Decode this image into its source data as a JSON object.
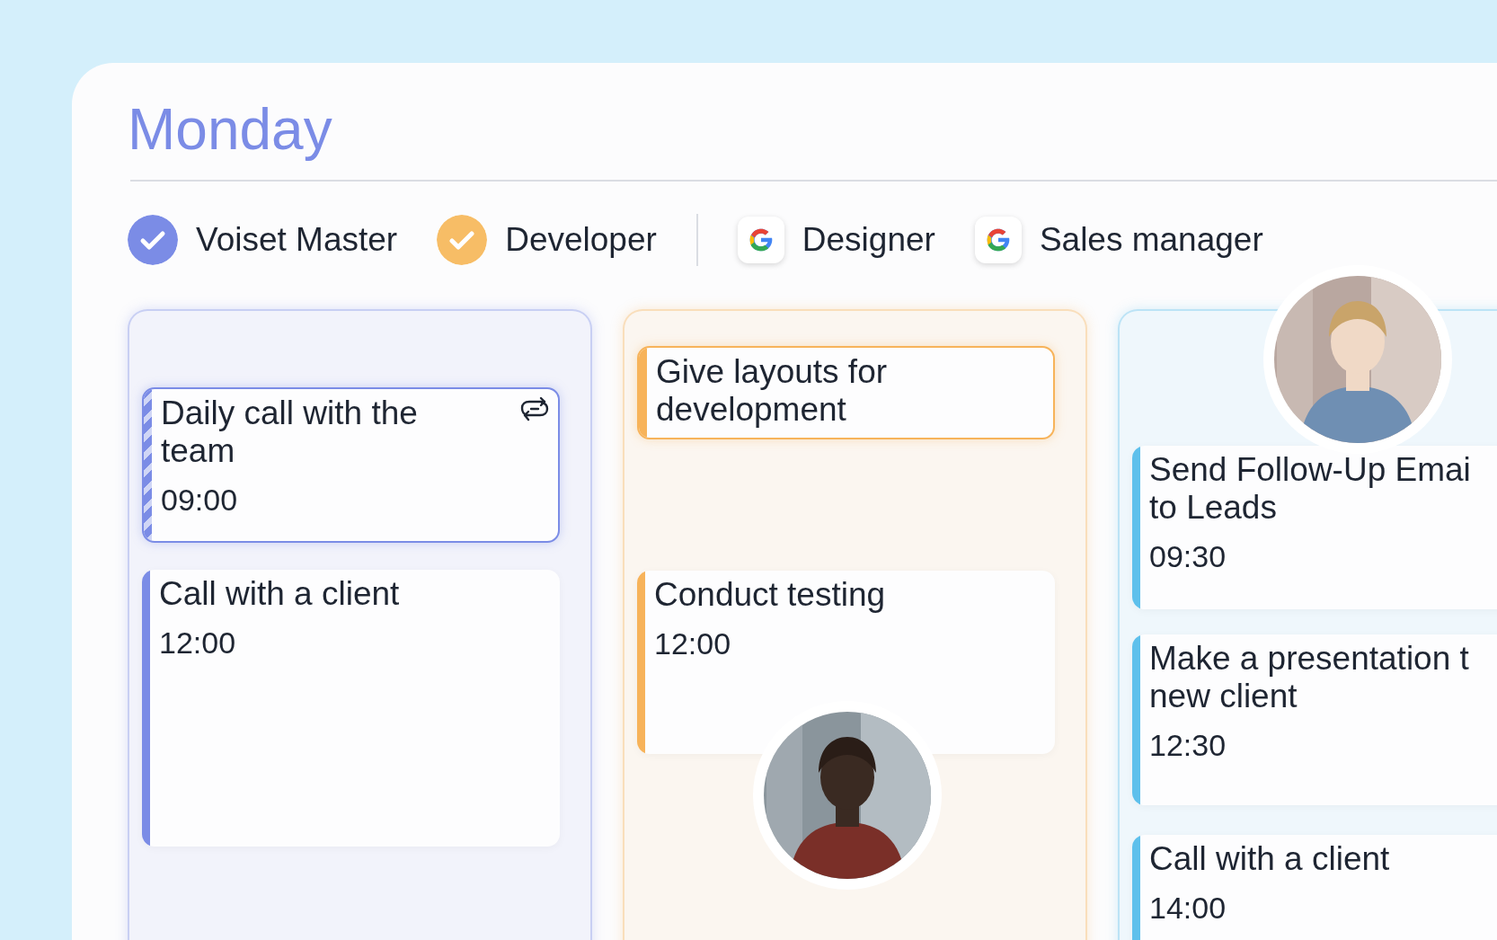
{
  "day": {
    "title": "Monday"
  },
  "calendars": [
    {
      "label": "Voiset Master",
      "kind": "check",
      "color": "#7b8ce6"
    },
    {
      "label": "Developer",
      "kind": "check",
      "color": "#f7bd66"
    },
    {
      "label": "Designer",
      "kind": "google"
    },
    {
      "label": "Sales manager",
      "kind": "google"
    }
  ],
  "columns": [
    {
      "color": "#7b8ce6",
      "events": [
        {
          "title_lines": [
            "Daily call with the",
            "team"
          ],
          "time": "09:00",
          "kind": "recurring"
        },
        {
          "title_lines": [
            "Call with a client"
          ],
          "time": "12:00",
          "kind": "plain"
        }
      ]
    },
    {
      "color": "#f7b35a",
      "avatar": {
        "kind": "picture"
      },
      "events": [
        {
          "title_lines": [
            "Give layouts for",
            "development"
          ],
          "kind": "outlined"
        },
        {
          "title_lines": [
            "Conduct testing"
          ],
          "time": "12:00",
          "kind": "plain"
        }
      ]
    },
    {
      "color": "#5ec0ec",
      "avatar": {
        "kind": "picture"
      },
      "events": [
        {
          "title_lines": [
            "Send Follow-Up Emai",
            "to Leads"
          ],
          "time": "09:30",
          "kind": "plain"
        },
        {
          "title_lines": [
            "Make a presentation t",
            "new client"
          ],
          "time": "12:30",
          "kind": "plain"
        },
        {
          "title_lines": [
            "Call with a client"
          ],
          "time": "14:00",
          "kind": "plain"
        }
      ]
    }
  ]
}
